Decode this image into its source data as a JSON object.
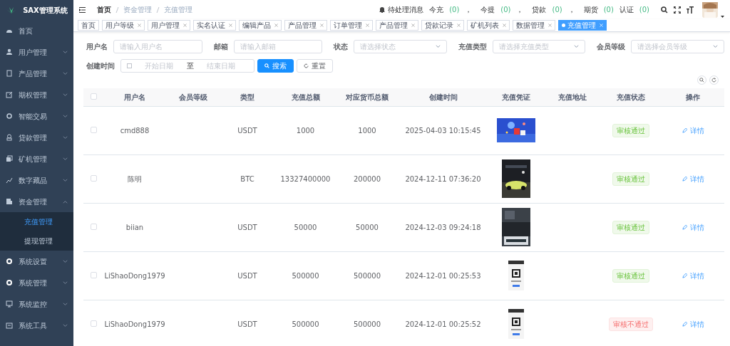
{
  "sidebar": {
    "logo_text": "SAX管理系统",
    "items": [
      {
        "label": "首页",
        "kind": "link"
      },
      {
        "label": "用户管理",
        "kind": "group",
        "expanded": false
      },
      {
        "label": "产品管理",
        "kind": "group",
        "expanded": false
      },
      {
        "label": "期权管理",
        "kind": "group",
        "expanded": false
      },
      {
        "label": "智能交易",
        "kind": "group",
        "expanded": false
      },
      {
        "label": "贷款管理",
        "kind": "group",
        "expanded": false
      },
      {
        "label": "矿机管理",
        "kind": "group",
        "expanded": false
      },
      {
        "label": "数字藏品",
        "kind": "group",
        "expanded": false
      },
      {
        "label": "资金管理",
        "kind": "group",
        "expanded": true,
        "children": [
          {
            "label": "充值管理",
            "selected": true
          },
          {
            "label": "提现管理",
            "selected": false
          }
        ]
      },
      {
        "label": "系统设置",
        "kind": "group",
        "expanded": false
      },
      {
        "label": "系统管理",
        "kind": "group",
        "expanded": false
      },
      {
        "label": "系统监控",
        "kind": "group",
        "expanded": false
      },
      {
        "label": "系统工具",
        "kind": "group",
        "expanded": false
      }
    ]
  },
  "breadcrumb": [
    "首页",
    "资金管理",
    "充值管理"
  ],
  "notice": {
    "label": "待处理消息",
    "counters": [
      {
        "label": "今充",
        "count": "(0)",
        "separator": "，"
      },
      {
        "label": "今提",
        "count": "(0)",
        "separator": "，"
      },
      {
        "label": "贷款",
        "count": "(0)",
        "separator": "，"
      },
      {
        "label": "期货",
        "count": "(0)"
      },
      {
        "label": "认证",
        "count": "(0)"
      }
    ]
  },
  "tags": [
    {
      "label": "首页",
      "selected": false,
      "closable": false
    },
    {
      "label": "用户等级",
      "selected": false,
      "closable": true
    },
    {
      "label": "用户管理",
      "selected": false,
      "closable": true
    },
    {
      "label": "实名认证",
      "selected": false,
      "closable": true
    },
    {
      "label": "编辑产品",
      "selected": false,
      "closable": true
    },
    {
      "label": "产品管理",
      "selected": false,
      "closable": true
    },
    {
      "label": "订单管理",
      "selected": false,
      "closable": true
    },
    {
      "label": "产品管理",
      "selected": false,
      "closable": true
    },
    {
      "label": "贷款记录",
      "selected": false,
      "closable": true
    },
    {
      "label": "矿机列表",
      "selected": false,
      "closable": true
    },
    {
      "label": "数据管理",
      "selected": false,
      "closable": true
    },
    {
      "label": "充值管理",
      "selected": true,
      "closable": true
    }
  ],
  "filters": {
    "fields": [
      {
        "label": "用户名",
        "placeholder": "请输入用户名",
        "kind": "text"
      },
      {
        "label": "邮箱",
        "placeholder": "请输入邮箱",
        "kind": "text"
      },
      {
        "label": "状态",
        "placeholder": "请选择状态",
        "kind": "select"
      },
      {
        "label": "充值类型",
        "placeholder": "请选择充值类型",
        "kind": "select"
      },
      {
        "label": "会员等级",
        "placeholder": "请选择会员等级",
        "kind": "select"
      }
    ],
    "date_range": {
      "label": "创建时间",
      "start_placeholder": "开始日期",
      "separator": "至",
      "end_placeholder": "结束日期"
    },
    "buttons": [
      {
        "label": "搜索",
        "kind": "primary"
      },
      {
        "label": "重置",
        "kind": "default"
      }
    ]
  },
  "table": {
    "header_checked": false,
    "columns": [
      "用户名",
      "会员等级",
      "类型",
      "充值总额",
      "对应货币总额",
      "创建时间",
      "充值凭证",
      "充值地址",
      "充值状态",
      "操作"
    ],
    "rows": [
      {
        "checked": false,
        "username": "cmd888",
        "type": "USDT",
        "total": "1000",
        "coin_total": "1000",
        "created": "2025-04-03 10:15:45",
        "status": {
          "text": "审核通过",
          "kind": "pass"
        },
        "action": "详情"
      },
      {
        "checked": false,
        "username": "陈明",
        "type": "BTC",
        "total": "13327400000",
        "coin_total": "200000",
        "created": "2024-12-11 07:36:20",
        "status": {
          "text": "审核通过",
          "kind": "pass"
        },
        "action": "详情"
      },
      {
        "checked": false,
        "username": "biian",
        "type": "USDT",
        "total": "50000",
        "coin_total": "50000",
        "created": "2024-12-03 09:24:18",
        "status": {
          "text": "审核通过",
          "kind": "pass"
        },
        "action": "详情"
      },
      {
        "checked": false,
        "username": "LiShaoDong1979",
        "type": "USDT",
        "total": "500000",
        "coin_total": "500000",
        "created": "2024-12-01 00:25:53",
        "status": {
          "text": "审核通过",
          "kind": "pass"
        },
        "action": "详情"
      },
      {
        "checked": false,
        "username": "LiShaoDong1979",
        "type": "USDT",
        "total": "500000",
        "coin_total": "500000",
        "created": "2024-12-01 00:25:52",
        "status": {
          "text": "审核不通过",
          "kind": "fail"
        },
        "action": "详情"
      }
    ]
  }
}
